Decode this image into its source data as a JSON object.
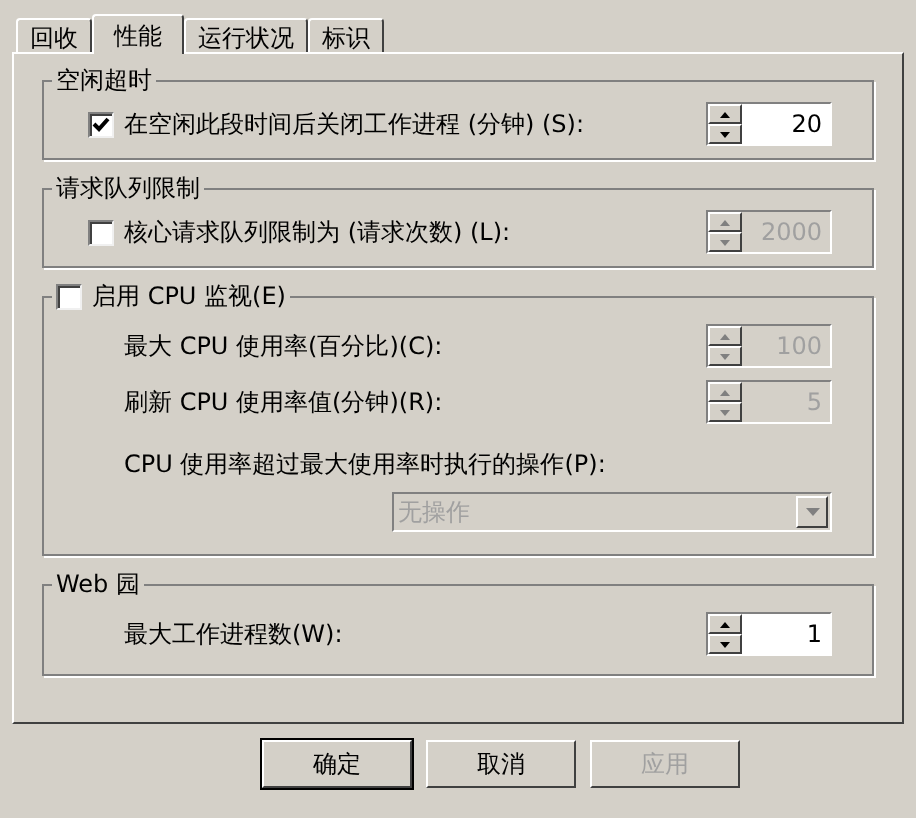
{
  "tabs": [
    {
      "label": "回收",
      "selected": false
    },
    {
      "label": "性能",
      "selected": true
    },
    {
      "label": "运行状况",
      "selected": false
    },
    {
      "label": "标识",
      "selected": false
    }
  ],
  "groups": [
    {
      "title": "空闲超时",
      "rows": [
        {
          "kind": "check_spinner",
          "label": "在空闲此段时间后关闭工作进程 (分钟) (S):",
          "checked": true,
          "value": "20",
          "disabled": false
        }
      ]
    },
    {
      "title": "请求队列限制",
      "rows": [
        {
          "kind": "check_spinner",
          "label": "核心请求队列限制为 (请求次数) (L):",
          "checked": false,
          "value": "2000",
          "disabled": true
        }
      ]
    },
    {
      "title_checkbox": {
        "label": "启用 CPU 监视(E)",
        "checked": false
      },
      "rows": [
        {
          "kind": "spinner",
          "label": "最大 CPU 使用率(百分比)(C):",
          "value": "100",
          "disabled": true
        },
        {
          "kind": "spinner",
          "label": "刷新 CPU 使用率值(分钟)(R):",
          "value": "5",
          "disabled": true
        },
        {
          "kind": "label",
          "label": "CPU 使用率超过最大使用率时执行的操作(P):"
        },
        {
          "kind": "dropdown",
          "value": "无操作",
          "disabled": true
        }
      ]
    },
    {
      "title": "Web 园",
      "rows": [
        {
          "kind": "spinner",
          "label": "最大工作进程数(W):",
          "value": "1",
          "disabled": false
        }
      ]
    }
  ],
  "buttons": [
    {
      "label": "确定",
      "disabled": false
    },
    {
      "label": "取消",
      "disabled": false
    },
    {
      "label": "应用",
      "disabled": true
    }
  ]
}
